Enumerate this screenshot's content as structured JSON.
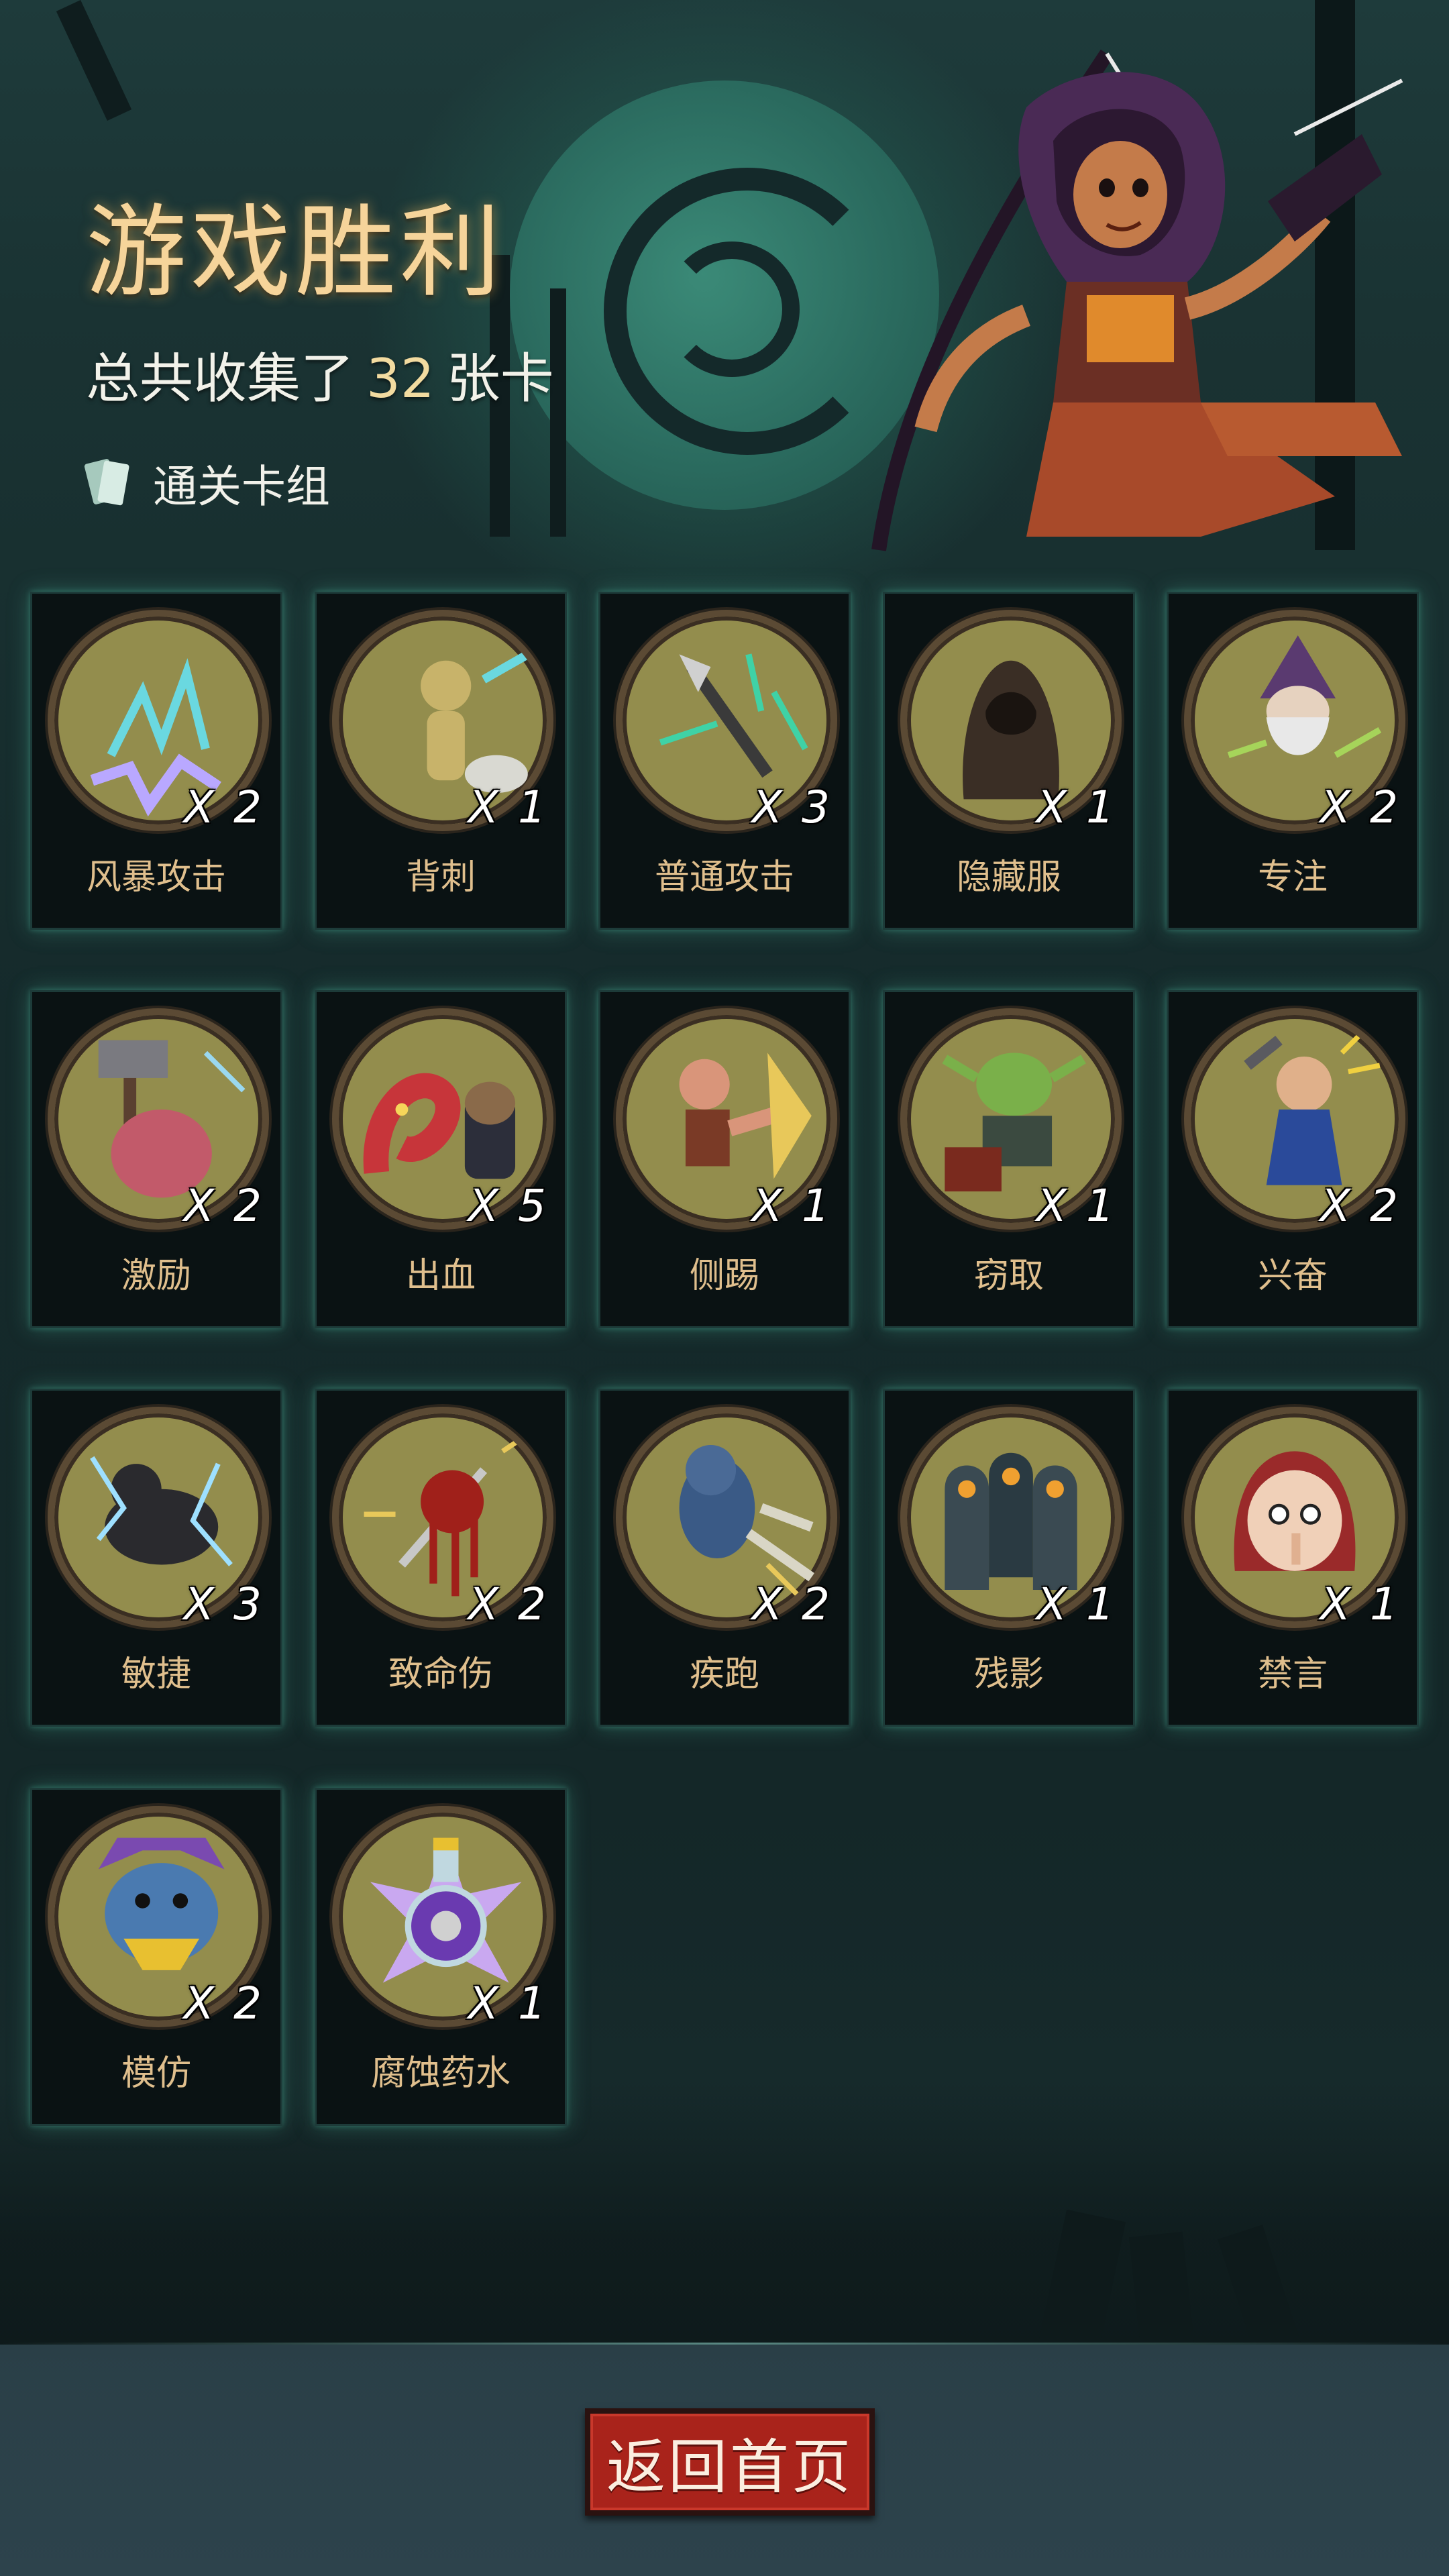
{
  "header": {
    "title": "游戏胜利",
    "summary_prefix": "总共收集了",
    "summary_count": "32",
    "summary_suffix": "张卡",
    "deck_button_label": "通关卡组"
  },
  "cards": [
    {
      "name": "风暴攻击",
      "qty": "X 2",
      "icon": "lightning-claw-icon"
    },
    {
      "name": "背刺",
      "qty": "X 1",
      "icon": "puppet-backstab-icon"
    },
    {
      "name": "普通攻击",
      "qty": "X 3",
      "icon": "spear-strike-icon"
    },
    {
      "name": "隐藏服",
      "qty": "X 1",
      "icon": "hooded-cloak-icon"
    },
    {
      "name": "专注",
      "qty": "X 2",
      "icon": "wizard-icon"
    },
    {
      "name": "激励",
      "qty": "X 2",
      "icon": "hammer-brute-icon"
    },
    {
      "name": "出血",
      "qty": "X 5",
      "icon": "tentacle-monster-icon"
    },
    {
      "name": "侧踢",
      "qty": "X 1",
      "icon": "kicking-fighter-icon"
    },
    {
      "name": "窃取",
      "qty": "X 1",
      "icon": "goblin-thief-icon"
    },
    {
      "name": "兴奋",
      "qty": "X 2",
      "icon": "excited-dwarf-icon"
    },
    {
      "name": "敏捷",
      "qty": "X 3",
      "icon": "panther-icon"
    },
    {
      "name": "致命伤",
      "qty": "X 2",
      "icon": "bleeding-dagger-icon"
    },
    {
      "name": "疾跑",
      "qty": "X 2",
      "icon": "running-werewolf-icon"
    },
    {
      "name": "残影",
      "qty": "X 1",
      "icon": "shadow-clones-icon"
    },
    {
      "name": "禁言",
      "qty": "X 1",
      "icon": "hushing-girl-icon"
    },
    {
      "name": "模仿",
      "qty": "X 2",
      "icon": "mimic-troll-icon"
    },
    {
      "name": "腐蚀药水",
      "qty": "X 1",
      "icon": "poison-potion-icon"
    }
  ],
  "footer": {
    "home_button_label": "返回首页"
  }
}
